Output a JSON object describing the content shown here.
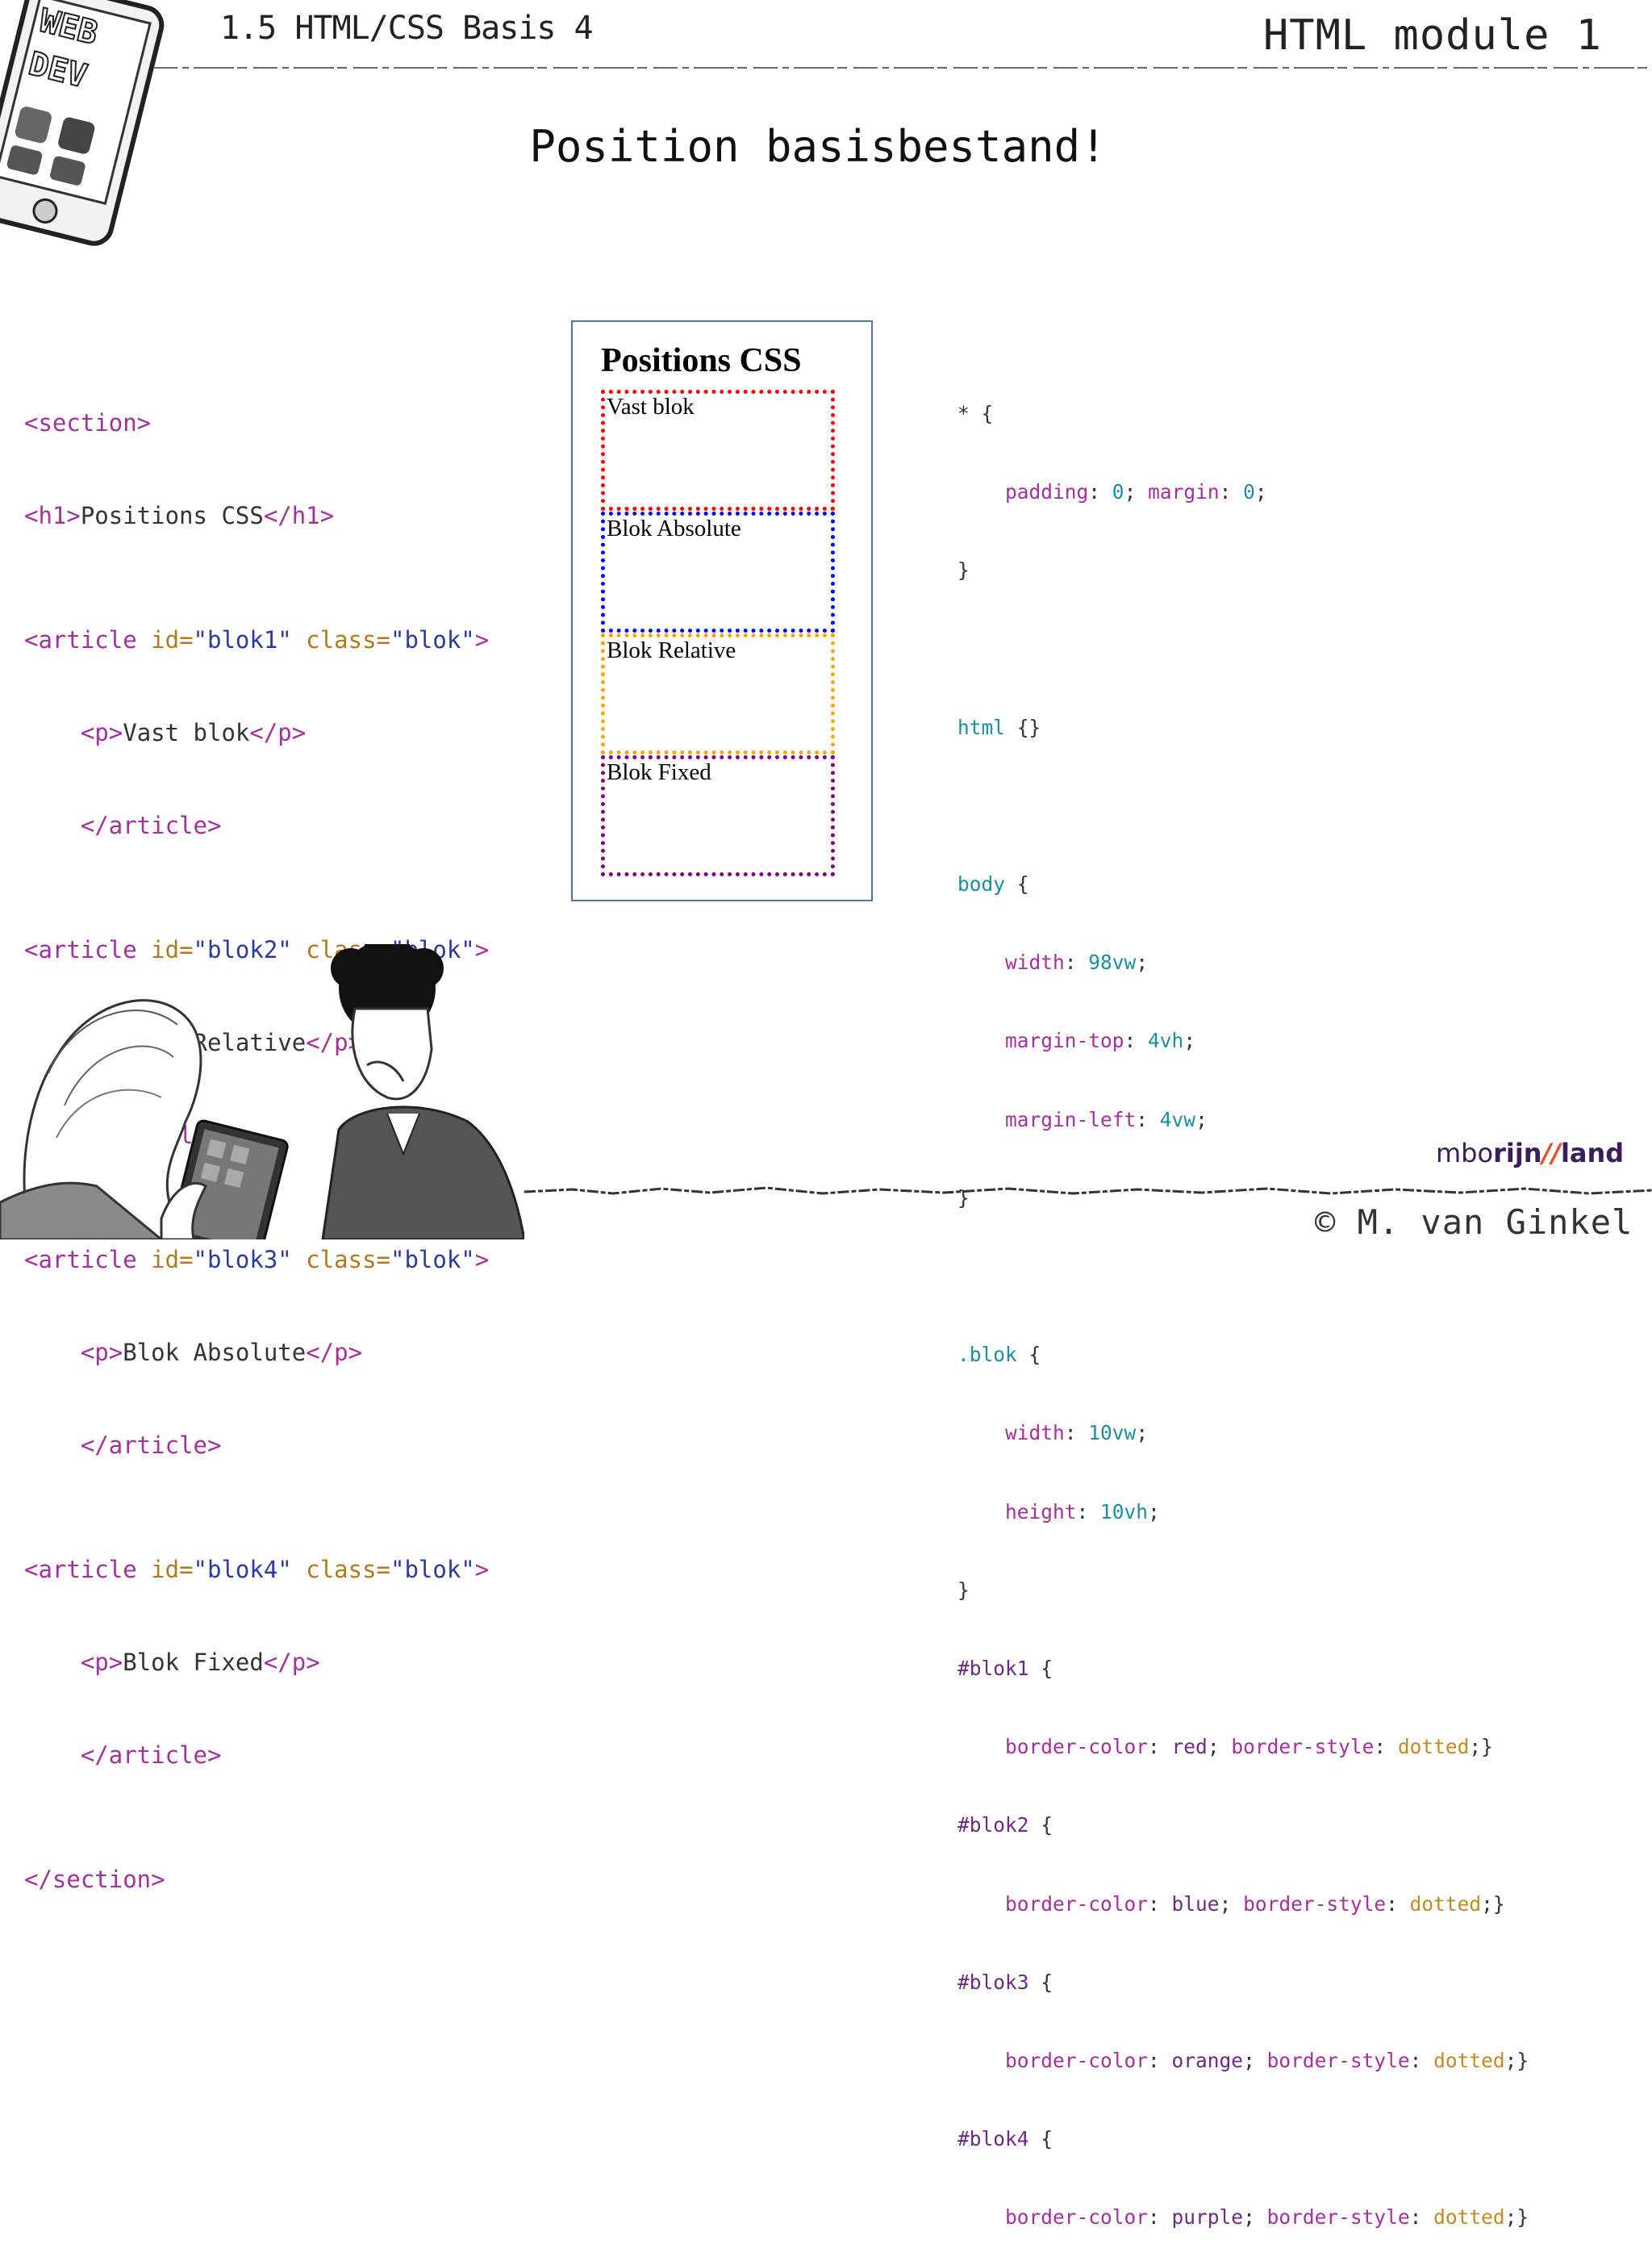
{
  "header": {
    "subtitle": "1.5 HTML/CSS Basis 4",
    "module": "HTML module 1",
    "title": "Position basisbestand!"
  },
  "phone_art": {
    "label_top": "WEB",
    "label_bottom": "DEV"
  },
  "html_code": {
    "l1": "<section>",
    "l2_open": "<h1>",
    "l2_text": "Positions CSS",
    "l2_close": "</h1>",
    "article_open": "<article",
    "id_attr": "id=",
    "class_attr": "class=",
    "class_val": "\"blok\"",
    "close_gt": ">",
    "p_open": "<p>",
    "p_close": "</p>",
    "article_close": "</article>",
    "l_end": "</section>",
    "blocks": [
      {
        "id_val": "\"blok1\"",
        "text": "Vast blok"
      },
      {
        "id_val": "\"blok2\"",
        "text": "Blok Relative"
      },
      {
        "id_val": "\"blok3\"",
        "text": "Blok Absolute"
      },
      {
        "id_val": "\"blok4\"",
        "text": "Blok Fixed"
      }
    ]
  },
  "preview": {
    "heading": "Positions CSS",
    "bloks": [
      "Vast blok",
      "Blok Absolute",
      "Blok Relative",
      "Blok Fixed"
    ]
  },
  "css_code": {
    "star": "* {",
    "padding": "padding",
    "zero": "0",
    "margin": "margin",
    "brace_close": "}",
    "html": "html",
    "html_braces": "{}",
    "body": "body",
    "brace_open": "{",
    "width": "width",
    "v98vw": "98vw",
    "margin_top": "margin-top",
    "v4vh": "4vh",
    "margin_left": "margin-left",
    "v4vw": "4vw",
    "blok_sel": ".blok",
    "v10vw": "10vw",
    "height": "height",
    "v10vh": "10vh",
    "rules": [
      {
        "sel": "#blok1",
        "color": "red"
      },
      {
        "sel": "#blok2",
        "color": "blue"
      },
      {
        "sel": "#blok3",
        "color": "orange"
      },
      {
        "sel": "#blok4",
        "color": "purple"
      }
    ],
    "border_color": "border-color",
    "border_style": "border-style",
    "dotted": "dotted"
  },
  "footer": {
    "logo_a": "mbo",
    "logo_b": "rijn",
    "logo_slash": "//",
    "logo_c": "land",
    "copyright": "© M. van Ginkel"
  },
  "colors": {
    "tag": "#a5309b",
    "attr": "#b07a21",
    "value": "#2a3aa0",
    "selector": "#1a8fa0",
    "preview_border": "#4a77a8"
  }
}
